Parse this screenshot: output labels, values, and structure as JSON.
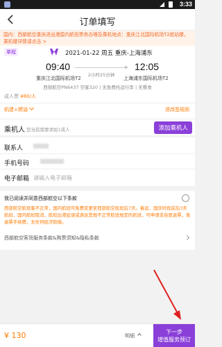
{
  "status_bar": {
    "time": "3:33"
  },
  "header": {
    "title": "订单填写"
  },
  "notice": "国内：西部航空重庆进出港国内航班票务办理及乘机地点：重庆江北国际机场T2航站楼，乘机楼详情请点击 >",
  "flight": {
    "tag": "单程",
    "date_route": "2021-01-22 周五  重庆-上海浦东",
    "dep_time": "09:40",
    "arr_time": "12:05",
    "duration": "2小时25分钟",
    "dep_airport": "重庆江北国际机场T2",
    "arr_airport": "上海浦东国际机场T2",
    "info": "西部航空PN6437  空客320 | 无免费托运行李 | 无餐食",
    "price_label": "成人票",
    "price_value": "¥80/人",
    "baggage_label": "机建+燃油",
    "refund_label": "退改签规则"
  },
  "passengers": {
    "title": "乘机人",
    "hint": "您当前需要添加1成人",
    "add_button": "添加乘机人"
  },
  "contact": {
    "name_label": "联系人",
    "phone_label": "手机号码",
    "email_label": "电子邮箱",
    "email_placeholder": "请输入电子邮箱"
  },
  "terms": {
    "title": "我已阅读并同意西部航空以下条款",
    "body": "西部航空航班客不正常，国内航班可免费变更至西部航空航班后7天。春运、国庆时段前后3天航班，国内航班取消，航班出港延误或满足其他不正常航班规定的航班，可申请非自愿退票，免退票手续费，无任何经济赔偿。",
    "link": "西部航空客货服务条款&购票须知&隐私条款"
  },
  "bottom": {
    "total": "¥ 130",
    "detail": "明细",
    "next_line1": "下一步",
    "next_line2": "增值服务预订"
  },
  "colors": {
    "accent": "#8b3fd9",
    "price": "#ff7a00",
    "arrow": "#e02020"
  }
}
